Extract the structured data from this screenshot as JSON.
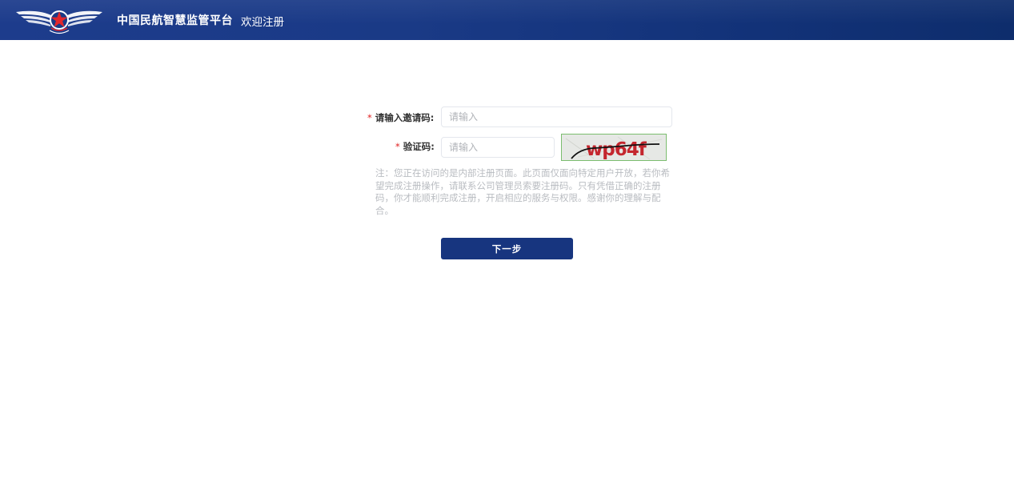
{
  "header": {
    "site_title": "中国民航智慧监管平台",
    "page_subtitle": "欢迎注册",
    "logo_icon": "civil-aviation-wings-star-icon",
    "brand_color": "#1a3a86"
  },
  "form": {
    "invite_code": {
      "required_mark": "*",
      "label": "请输入邀请码:",
      "value": "",
      "placeholder": "请输入"
    },
    "captcha": {
      "required_mark": "*",
      "label": "验证码:",
      "value": "",
      "placeholder": "请输入",
      "image_text": "wp64f"
    },
    "note": "注：您正在访问的是内部注册页面。此页面仅面向特定用户开放，若你希望完成注册操作，请联系公司管理员索要注册码。只有凭借正确的注册码，你才能顺利完成注册，开启相应的服务与权限。感谢你的理解与配合。",
    "next_label": "下一步"
  },
  "colors": {
    "required": "#e02020",
    "button": "#17357f",
    "note": "#b9bcc1"
  }
}
